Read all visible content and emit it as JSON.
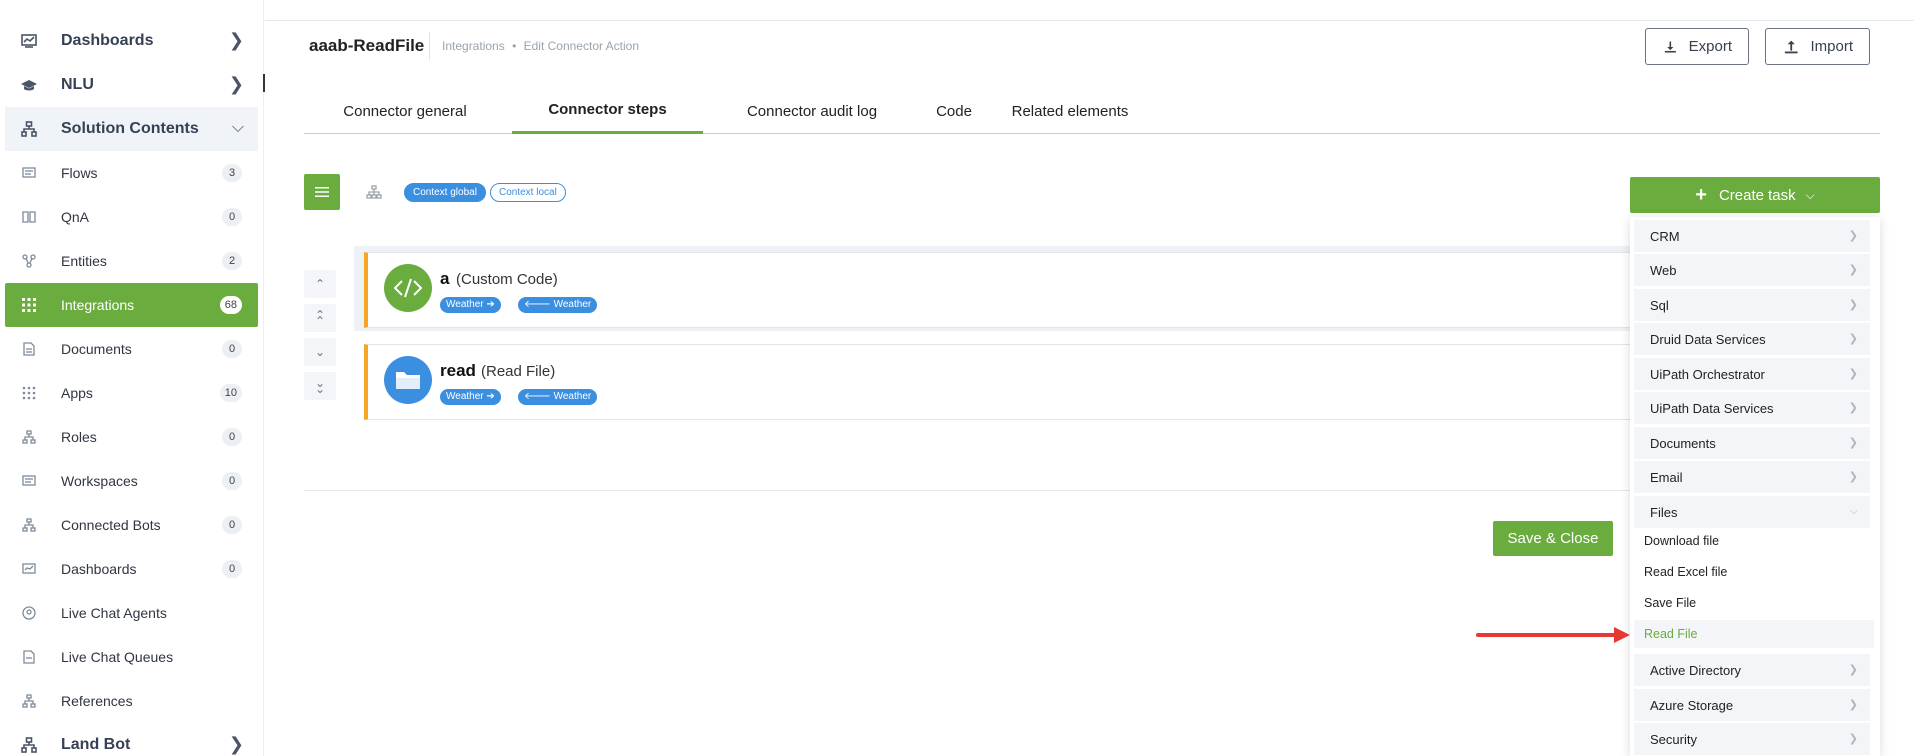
{
  "sidebar": {
    "top_items": [
      {
        "label": "Dashboards",
        "icon": "chart-icon"
      },
      {
        "label": "NLU",
        "icon": "graduation-cap-icon"
      },
      {
        "label": "Solution Contents",
        "icon": "sitemap-icon"
      }
    ],
    "items": [
      {
        "label": "Flows",
        "count": "3"
      },
      {
        "label": "QnA",
        "count": "0"
      },
      {
        "label": "Entities",
        "count": "2"
      },
      {
        "label": "Integrations",
        "count": "68"
      },
      {
        "label": "Documents",
        "count": "0"
      },
      {
        "label": "Apps",
        "count": "10"
      },
      {
        "label": "Roles",
        "count": "0"
      },
      {
        "label": "Workspaces",
        "count": "0"
      },
      {
        "label": "Connected Bots",
        "count": "0"
      },
      {
        "label": "Dashboards",
        "count": "0"
      },
      {
        "label": "Live Chat Agents",
        "count": ""
      },
      {
        "label": "Live Chat Queues",
        "count": ""
      },
      {
        "label": "References",
        "count": ""
      }
    ],
    "bottom_item": {
      "label": "Land Bot",
      "icon": "sitemap-icon"
    },
    "active_color": "#6aac3d"
  },
  "header": {
    "title": "aaab-ReadFile",
    "breadcrumb": [
      "Integrations",
      "•",
      "Edit Connector Action"
    ],
    "export_label": "Export",
    "import_label": "Import"
  },
  "tabs": [
    {
      "label": "Connector general"
    },
    {
      "label": "Connector steps"
    },
    {
      "label": "Connector audit log"
    },
    {
      "label": "Code"
    },
    {
      "label": "Related elements"
    }
  ],
  "toolbar": {
    "context_global": "Context global",
    "context_local": "Context local",
    "create_task_label": "Create task"
  },
  "steps": [
    {
      "name": "a",
      "type": "(Custom Code)",
      "tag_out": "Weather ➔",
      "tag_in": "🡐 Weather",
      "icon": "code-icon",
      "icon_color": "#6aac3d"
    },
    {
      "name": "read",
      "type": "(Read File)",
      "tag_out": "Weather ➔",
      "tag_in": "🡐 Weather",
      "icon": "folder-icon",
      "icon_color": "#3b8fe0"
    }
  ],
  "save_close_label": "Save & Close",
  "dropdown": {
    "categories_before": [
      "CRM",
      "Web",
      "Sql",
      "Druid Data Services",
      "UiPath Orchestrator",
      "UiPath Data Services",
      "Documents",
      "Email"
    ],
    "expanded_category": "Files",
    "files_items": [
      "Download file",
      "Read Excel file",
      "Save File",
      "Read File"
    ],
    "selected_item": "Read File",
    "categories_after": [
      "Active Directory",
      "Azure Storage",
      "Security"
    ]
  }
}
